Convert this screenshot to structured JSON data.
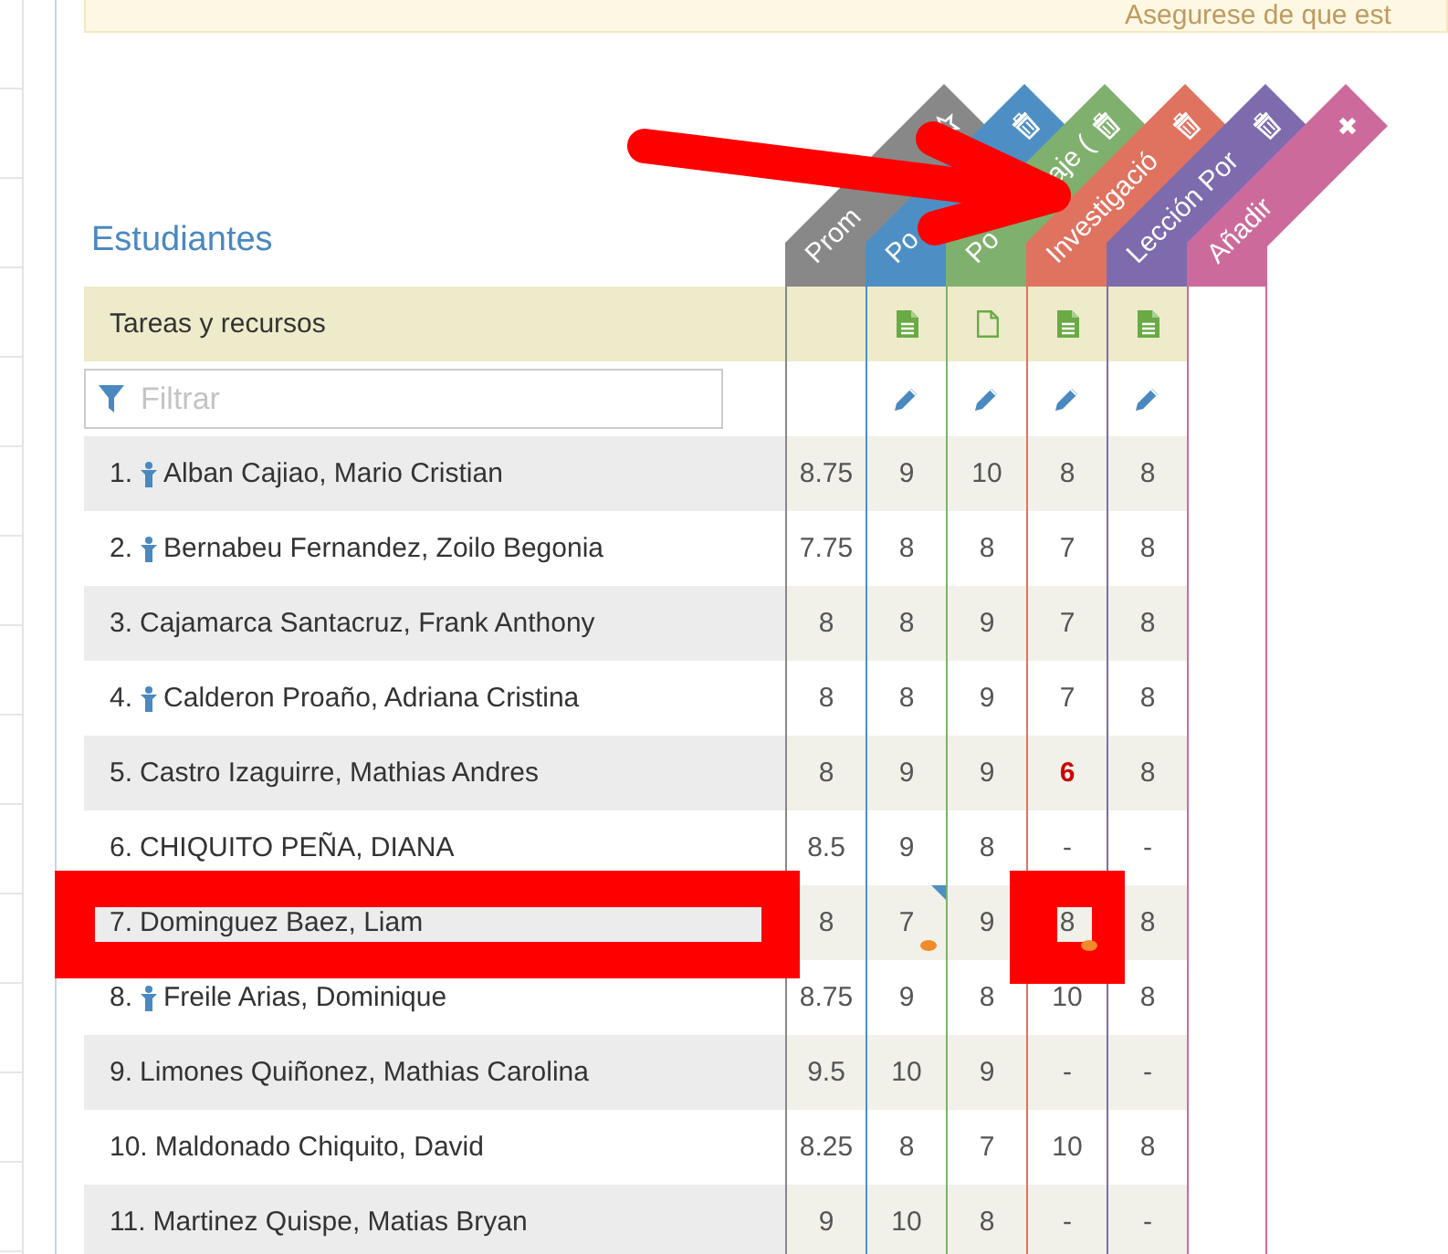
{
  "alert": {
    "text": "Asegurese de que est"
  },
  "section_title": "Estudiantes",
  "columns": [
    {
      "label": "Prom",
      "color": "#888888",
      "kind": "star"
    },
    {
      "label": "Po",
      "color": "#4d8fc4",
      "kind": "trash"
    },
    {
      "label": "Po",
      "label_tail": "aje (",
      "color": "#80b06e",
      "kind": "trash"
    },
    {
      "label": "Investigació",
      "color": "#e07260",
      "kind": "trash"
    },
    {
      "label": "Lección Por",
      "color": "#7d6bae",
      "kind": "trash"
    },
    {
      "label": "Añadir",
      "color": "#cc6b9b",
      "kind": "close"
    }
  ],
  "resources_label": "Tareas y recursos",
  "resources": [
    {
      "kind": "none"
    },
    {
      "kind": "filled"
    },
    {
      "kind": "outline"
    },
    {
      "kind": "filled"
    },
    {
      "kind": "filled"
    },
    {
      "kind": "none"
    }
  ],
  "editable": [
    false,
    true,
    true,
    true,
    true,
    false
  ],
  "filter": {
    "placeholder": "Filtrar"
  },
  "rows": [
    {
      "number": "1.",
      "person_icon": true,
      "name": "Alban Cajiao, Mario Cristian",
      "grades": [
        {
          "value": "8.75"
        },
        {
          "value": "9"
        },
        {
          "value": "10"
        },
        {
          "value": "8"
        },
        {
          "value": "8"
        }
      ]
    },
    {
      "number": "2.",
      "person_icon": true,
      "name": "Bernabeu Fernandez, Zoilo Begonia",
      "grades": [
        {
          "value": "7.75"
        },
        {
          "value": "8"
        },
        {
          "value": "8"
        },
        {
          "value": "7"
        },
        {
          "value": "8"
        }
      ]
    },
    {
      "number": "3.",
      "name": "Cajamarca Santacruz, Frank Anthony",
      "grades": [
        {
          "value": "8"
        },
        {
          "value": "8"
        },
        {
          "value": "9"
        },
        {
          "value": "7"
        },
        {
          "value": "8"
        }
      ]
    },
    {
      "number": "4.",
      "person_icon": true,
      "name": "Calderon Proaño, Adriana Cristina",
      "grades": [
        {
          "value": "8"
        },
        {
          "value": "8"
        },
        {
          "value": "9"
        },
        {
          "value": "7"
        },
        {
          "value": "8"
        }
      ]
    },
    {
      "number": "5.",
      "name": "Castro Izaguirre, Mathias Andres",
      "grades": [
        {
          "value": "8"
        },
        {
          "value": "9"
        },
        {
          "value": "9"
        },
        {
          "value": "6",
          "low": true
        },
        {
          "value": "8"
        }
      ]
    },
    {
      "number": "6.",
      "name": "CHIQUITO PEÑA, DIANA",
      "grades": [
        {
          "value": "8.5"
        },
        {
          "value": "9"
        },
        {
          "value": "8"
        },
        {
          "value": "-"
        },
        {
          "value": "-"
        }
      ]
    },
    {
      "number": "7.",
      "framed": true,
      "name": "Dominguez Baez, Liam",
      "grades": [
        {
          "value": "8"
        },
        {
          "value": "7",
          "flagged": true,
          "comment": true
        },
        {
          "value": "9"
        },
        {
          "value": "8",
          "comment": true,
          "framed": true
        },
        {
          "value": "8"
        }
      ]
    },
    {
      "number": "8.",
      "person_icon": true,
      "name": "Freile Arias, Dominique",
      "grades": [
        {
          "value": "8.75"
        },
        {
          "value": "9"
        },
        {
          "value": "8"
        },
        {
          "value": "10"
        },
        {
          "value": "8"
        }
      ]
    },
    {
      "number": "9.",
      "name": "Limones Quiñonez, Mathias Carolina",
      "grades": [
        {
          "value": "9.5"
        },
        {
          "value": "10"
        },
        {
          "value": "9"
        },
        {
          "value": "-"
        },
        {
          "value": "-"
        }
      ]
    },
    {
      "number": "10.",
      "name": "Maldonado Chiquito, David",
      "grades": [
        {
          "value": "8.25"
        },
        {
          "value": "8"
        },
        {
          "value": "7"
        },
        {
          "value": "10"
        },
        {
          "value": "8"
        }
      ]
    },
    {
      "number": "11.",
      "name": "Martinez Quispe, Matias Bryan",
      "grades": [
        {
          "value": "9"
        },
        {
          "value": "10"
        },
        {
          "value": "8"
        },
        {
          "value": "-"
        },
        {
          "value": "-"
        }
      ]
    }
  ],
  "annotations": [
    {
      "kind": "arrow"
    }
  ]
}
